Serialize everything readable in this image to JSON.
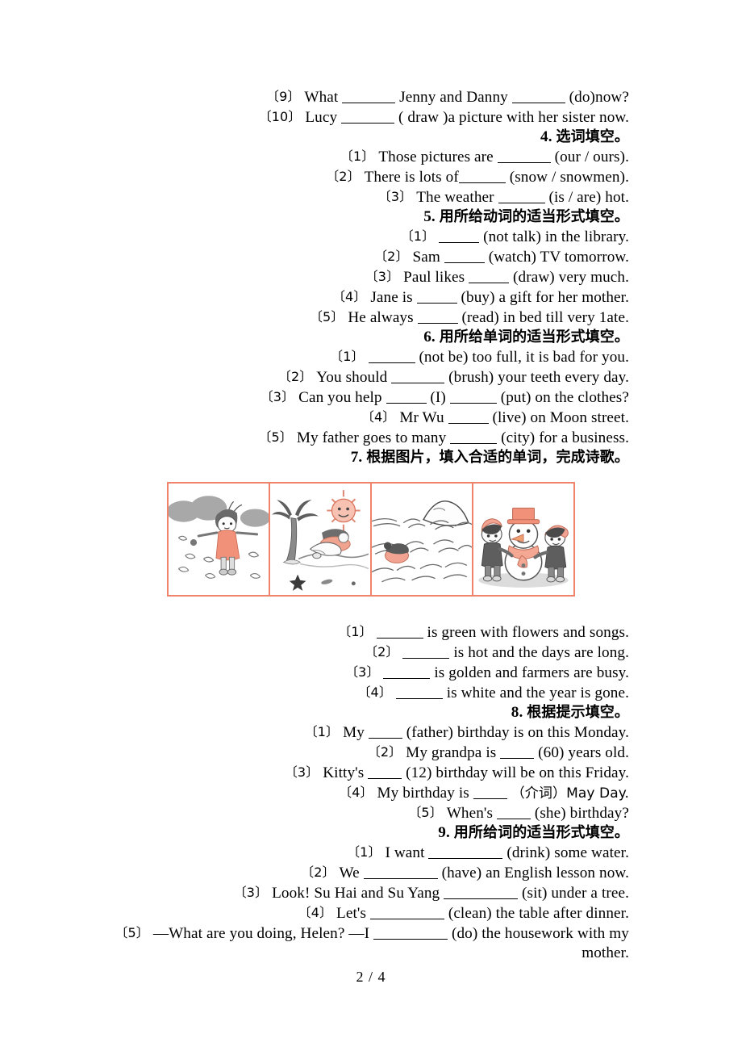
{
  "document": {
    "page_label": "2 / 4",
    "figure_border_color": "#f0846b",
    "illustration_accent_color": "#f2917a"
  },
  "carryover": {
    "items": [
      {
        "num": "〔9〕",
        "text_before": "What",
        "blank1": "",
        "text_mid": "Jenny and Danny",
        "blank2": "",
        "text_after": "(do)now?",
        "full": "〔9〕What ________ Jenny and Danny ________ (do)now?"
      },
      {
        "num": "〔10〕",
        "full": "〔10〕Lucy ________ ( draw )a picture with her sister now."
      }
    ]
  },
  "sections": [
    {
      "number": "4.",
      "title_cn": "选词填空。",
      "heading_full": "4. 选词填空。",
      "items": [
        {
          "num": "〔1〕",
          "pre": "Those pictures are",
          "post": "(our / ours).",
          "blank_width": "w8"
        },
        {
          "num": "〔2〕",
          "pre": "There is lots of",
          "post": "(snow / snowmen).",
          "blank_width": "w7"
        },
        {
          "num": "〔3〕",
          "pre": "The weather",
          "post": "(is / are) hot.",
          "blank_width": "w7"
        }
      ]
    },
    {
      "number": "5.",
      "title_cn": "用所给动词的适当形式填空。",
      "heading_full": "5. 用所给动词的适当形式填空。",
      "items": [
        {
          "num": "〔1〕",
          "pre": "",
          "post": "(not talk) in the library.",
          "blank_width": "w6"
        },
        {
          "num": "〔2〕",
          "pre": "Sam",
          "post": "(watch) TV tomorrow.",
          "blank_width": "w6"
        },
        {
          "num": "〔3〕",
          "pre": "Paul likes",
          "post": "(draw) very much.",
          "blank_width": "w6"
        },
        {
          "num": "〔4〕",
          "pre": "Jane is",
          "post": "(buy) a gift for her mother.",
          "blank_width": "w6"
        },
        {
          "num": "〔5〕",
          "pre": "He always",
          "post": "(read) in bed till very 1ate.",
          "blank_width": "w6"
        }
      ]
    },
    {
      "number": "6.",
      "title_cn": "用所给单词的适当形式填空。",
      "heading_full": "6. 用所给单词的适当形式填空。",
      "items": [
        {
          "num": "〔1〕",
          "pre": "",
          "post": "(not be) too full, it is bad for you.",
          "blank_width": "w7"
        },
        {
          "num": "〔2〕",
          "pre": "You should",
          "post": "(brush) your teeth every day.",
          "blank_width": "w8"
        },
        {
          "num": "〔3〕",
          "pre": "Can you help",
          "mid": "(I)",
          "post": "(put) on the clothes?",
          "blank_width": "w6",
          "blank2_width": "w7"
        },
        {
          "num": "〔4〕",
          "pre": "Mr Wu",
          "post": "(live) on Moon street.",
          "blank_width": "w6"
        },
        {
          "num": "〔5〕",
          "pre": "My father goes to many",
          "post": "(city) for a business.",
          "blank_width": "w7"
        }
      ]
    },
    {
      "number": "7.",
      "title_cn": "根据图片，填入合适的单词，完成诗歌。",
      "heading_full": "7. 根据图片，填入合适的单词，完成诗歌。",
      "has_figure": true,
      "figure": {
        "panels": [
          {
            "name": "spring-panel",
            "season_hint": "spring",
            "description": "girl in pink dress with flowers, bushes and butterflies"
          },
          {
            "name": "summer-panel",
            "season_hint": "summer",
            "description": "palm tree, smiling sun and person relaxing on the beach"
          },
          {
            "name": "autumn-panel",
            "season_hint": "autumn",
            "description": "golden fields with mountain and a farmer harvesting"
          },
          {
            "name": "winter-panel",
            "season_hint": "winter",
            "description": "two children building a snowman with hat and scarf"
          }
        ]
      },
      "items": [
        {
          "num": "〔1〕",
          "pre": "",
          "post": "is green with flowers and songs.",
          "blank_width": "w7"
        },
        {
          "num": "〔2〕",
          "pre": "",
          "post": "is hot and the days are long.",
          "blank_width": "w7"
        },
        {
          "num": "〔3〕",
          "pre": "",
          "post": "is golden and farmers are busy.",
          "blank_width": "w7"
        },
        {
          "num": "〔4〕",
          "pre": "",
          "post": "is white and the year is gone.",
          "blank_width": "w7"
        }
      ]
    },
    {
      "number": "8.",
      "title_cn": "根据提示填空。",
      "heading_full": "8. 根据提示填空。",
      "items": [
        {
          "num": "〔1〕",
          "pre": "My",
          "post": "(father) birthday is on this Monday.",
          "blank_width": "w5"
        },
        {
          "num": "〔2〕",
          "pre": "My grandpa is",
          "post": "(60) years old.",
          "blank_width": "w5"
        },
        {
          "num": "〔3〕",
          "pre": "Kitty's",
          "post": "(12) birthday will be on this Friday.",
          "blank_width": "w5"
        },
        {
          "num": "〔4〕",
          "pre": "My birthday is",
          "post": "（介词）May Day.",
          "blank_width": "w5",
          "has_cn": true
        },
        {
          "num": "〔5〕",
          "pre": "When's",
          "post": "(she) birthday?",
          "blank_width": "w5"
        }
      ]
    },
    {
      "number": "9.",
      "title_cn": "用所给词的适当形式填空。",
      "heading_full": "9. 用所给词的适当形式填空。",
      "items": [
        {
          "num": "〔1〕",
          "pre": "I want",
          "post": "(drink) some water.",
          "blank_width": "w11"
        },
        {
          "num": "〔2〕",
          "pre": "We",
          "post": "(have) an English lesson now.",
          "blank_width": "w11"
        },
        {
          "num": "〔3〕",
          "pre": "Look! Su Hai and Su Yang",
          "post": "(sit) under a tree.",
          "blank_width": "w11"
        },
        {
          "num": "〔4〕",
          "pre": "Let's",
          "post": "(clean) the table after dinner.",
          "blank_width": "w11"
        },
        {
          "num": "〔5〕",
          "pre": "—What are you doing, Helen? —I",
          "post": "(do) the housework with my",
          "blank_width": "w11",
          "continuation": "mother."
        }
      ]
    }
  ]
}
